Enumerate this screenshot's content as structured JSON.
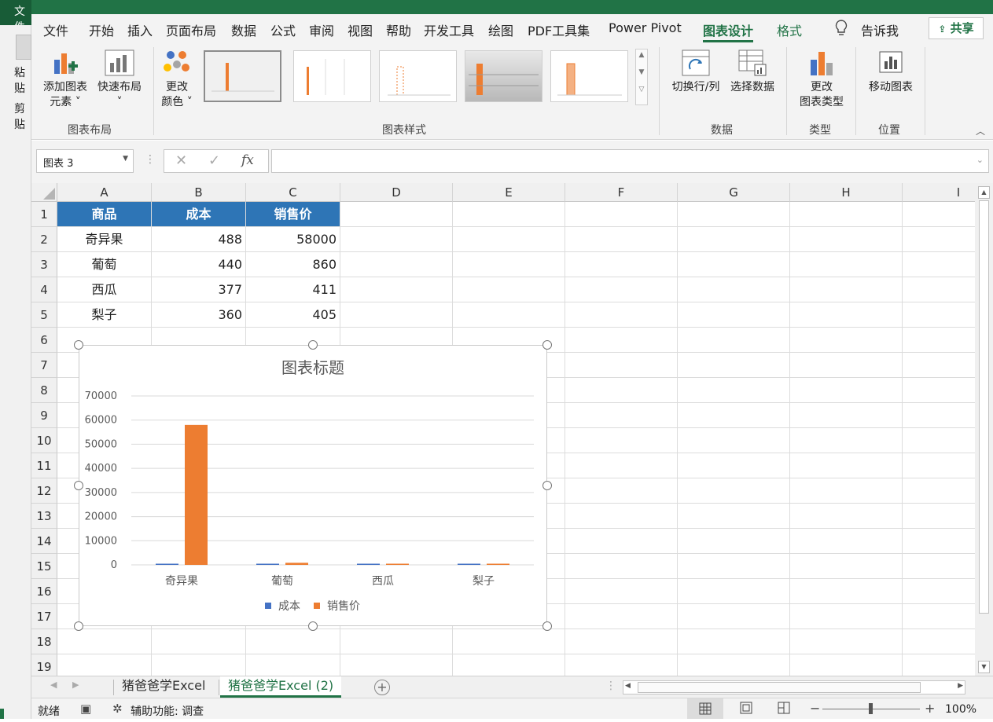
{
  "ribbon_tabs": {
    "file": "文件",
    "home": "开始",
    "insert": "插入",
    "page_layout": "页面布局",
    "data": "数据",
    "formulas": "公式",
    "review": "审阅",
    "view": "视图",
    "help": "帮助",
    "developer": "开发工具",
    "draw": "绘图",
    "pdf_tools": "PDF工具集",
    "power_pivot": "Power Pivot",
    "chart_design": "图表设计",
    "format": "格式",
    "tell_me": "告诉我",
    "share": "共享"
  },
  "left_strip": {
    "file_tab": "文件",
    "paste": "粘贴",
    "clipboard": "剪贴"
  },
  "ribbon": {
    "add_element_line1": "添加图表",
    "add_element_line2": "元素",
    "quick_layout": "快速布局",
    "change_colors_line1": "更改",
    "change_colors_line2": "颜色",
    "switch_row_col": "切换行/列",
    "select_data": "选择数据",
    "change_type_line1": "更改",
    "change_type_line2": "图表类型",
    "move_chart": "移动图表",
    "group_layout": "图表布局",
    "group_styles": "图表样式",
    "group_data": "数据",
    "group_type": "类型",
    "group_location": "位置"
  },
  "formula_bar": {
    "name_box": "图表 3",
    "content": ""
  },
  "grid": {
    "columns": [
      "A",
      "B",
      "C",
      "D",
      "E",
      "F",
      "G",
      "H",
      "I"
    ],
    "rows": [
      "1",
      "2",
      "3",
      "4",
      "5",
      "6",
      "7",
      "8",
      "9",
      "10",
      "11",
      "12",
      "13",
      "14",
      "15",
      "16",
      "17",
      "18",
      "19"
    ],
    "table_headers": [
      "商品",
      "成本",
      "销售价"
    ],
    "table_rows": [
      [
        "奇异果",
        "488",
        "58000"
      ],
      [
        "葡萄",
        "440",
        "860"
      ],
      [
        "西瓜",
        "377",
        "411"
      ],
      [
        "梨子",
        "360",
        "405"
      ]
    ]
  },
  "chart_data": {
    "type": "bar",
    "title": "图表标题",
    "categories": [
      "奇异果",
      "葡萄",
      "西瓜",
      "梨子"
    ],
    "series": [
      {
        "name": "成本",
        "values": [
          488,
          440,
          377,
          360
        ],
        "color": "#4472c4"
      },
      {
        "name": "销售价",
        "values": [
          58000,
          860,
          411,
          405
        ],
        "color": "#ed7d31"
      }
    ],
    "ylim": [
      0,
      70000
    ],
    "yticks": [
      0,
      10000,
      20000,
      30000,
      40000,
      50000,
      60000,
      70000
    ],
    "grid": true,
    "legend": "bottom"
  },
  "sheets": {
    "tab1": "猪爸爸学Excel",
    "tab2": "猪爸爸学Excel (2)"
  },
  "status": {
    "ready": "就绪",
    "accessibility": "辅助功能: 调查",
    "zoom": "100%"
  },
  "colors": {
    "excel_green": "#217346",
    "header_blue": "#2e75b6"
  }
}
